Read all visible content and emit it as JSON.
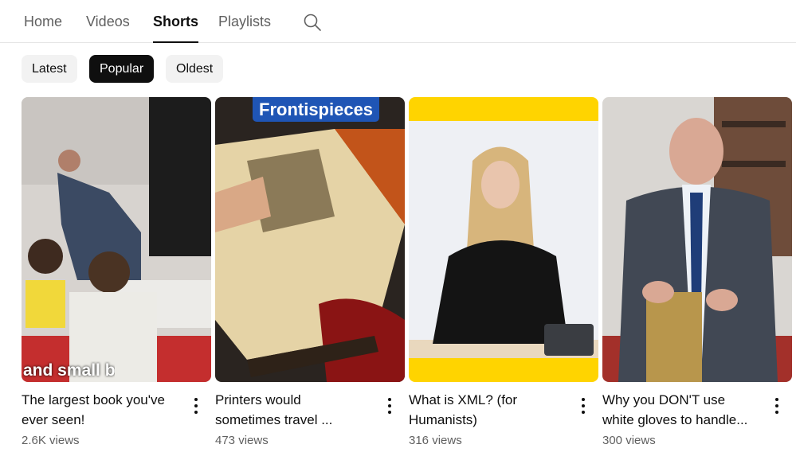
{
  "tabs": {
    "home": "Home",
    "videos": "Videos",
    "shorts": "Shorts",
    "playlists": "Playlists",
    "active": "Shorts"
  },
  "search": {
    "icon": "search-icon"
  },
  "filters": {
    "latest": "Latest",
    "popular": "Popular",
    "oldest": "Oldest",
    "active": "Popular"
  },
  "shorts": [
    {
      "title_line1": "The largest book you've",
      "title_line2": "ever seen!",
      "views": "2.6K views",
      "overlay_text": "and small b"
    },
    {
      "title_line1": "Printers would",
      "title_line2": "sometimes travel ...",
      "views": "473 views",
      "overlay_text": "Frontispieces"
    },
    {
      "title_line1": "What is XML? (for",
      "title_line2": "Humanists)",
      "views": "316 views"
    },
    {
      "title_line1": "Why you DON'T use",
      "title_line2": "white gloves to handle...",
      "views": "300 views"
    }
  ],
  "colors": {
    "text": "#0f0f0f",
    "secondary_text": "#606060",
    "chip_bg": "#f2f2f2",
    "chip_active_bg": "#0f0f0f",
    "overlay_label_bg": "#1f55b5",
    "xml_frame": "#ffd400"
  }
}
